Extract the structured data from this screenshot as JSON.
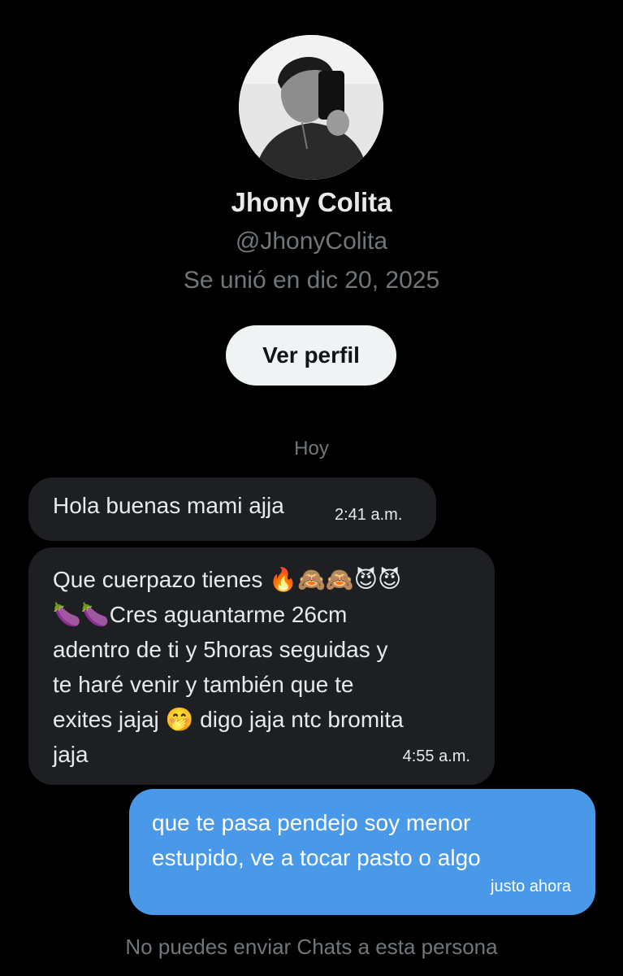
{
  "profile": {
    "name": "Jhony Colita",
    "handle": "@JhonyColita",
    "joined": "Se unió en dic 20, 2025",
    "view_profile_label": "Ver perfil"
  },
  "conversation": {
    "day_separator": "Hoy",
    "messages": [
      {
        "direction": "incoming",
        "text": "Hola buenas mami ajja",
        "time": "2:41 a.m."
      },
      {
        "direction": "incoming",
        "text": "Que cuerpazo tienes 🔥🙈🙈😈😈\n🍆🍆Cres aguantarme 26cm\nadentro de ti y 5horas seguidas y\nte haré venir y también que te\nexites jajaj 🤭 digo jaja ntc bromita\njaja",
        "time": "4:55 a.m."
      },
      {
        "direction": "outgoing",
        "text": "que te pasa pendejo soy menor\nestupido, ve a tocar pasto o algo",
        "time": "justo ahora"
      }
    ],
    "footer_notice": "No puedes enviar Chats a esta persona"
  },
  "colors": {
    "background": "#000000",
    "incoming_bubble": "#1d1f23",
    "outgoing_bubble": "#4a99e9",
    "secondary_text": "#71767b",
    "button_bg": "#eff3f4"
  },
  "icons": {
    "avatar": "profile-photo"
  }
}
